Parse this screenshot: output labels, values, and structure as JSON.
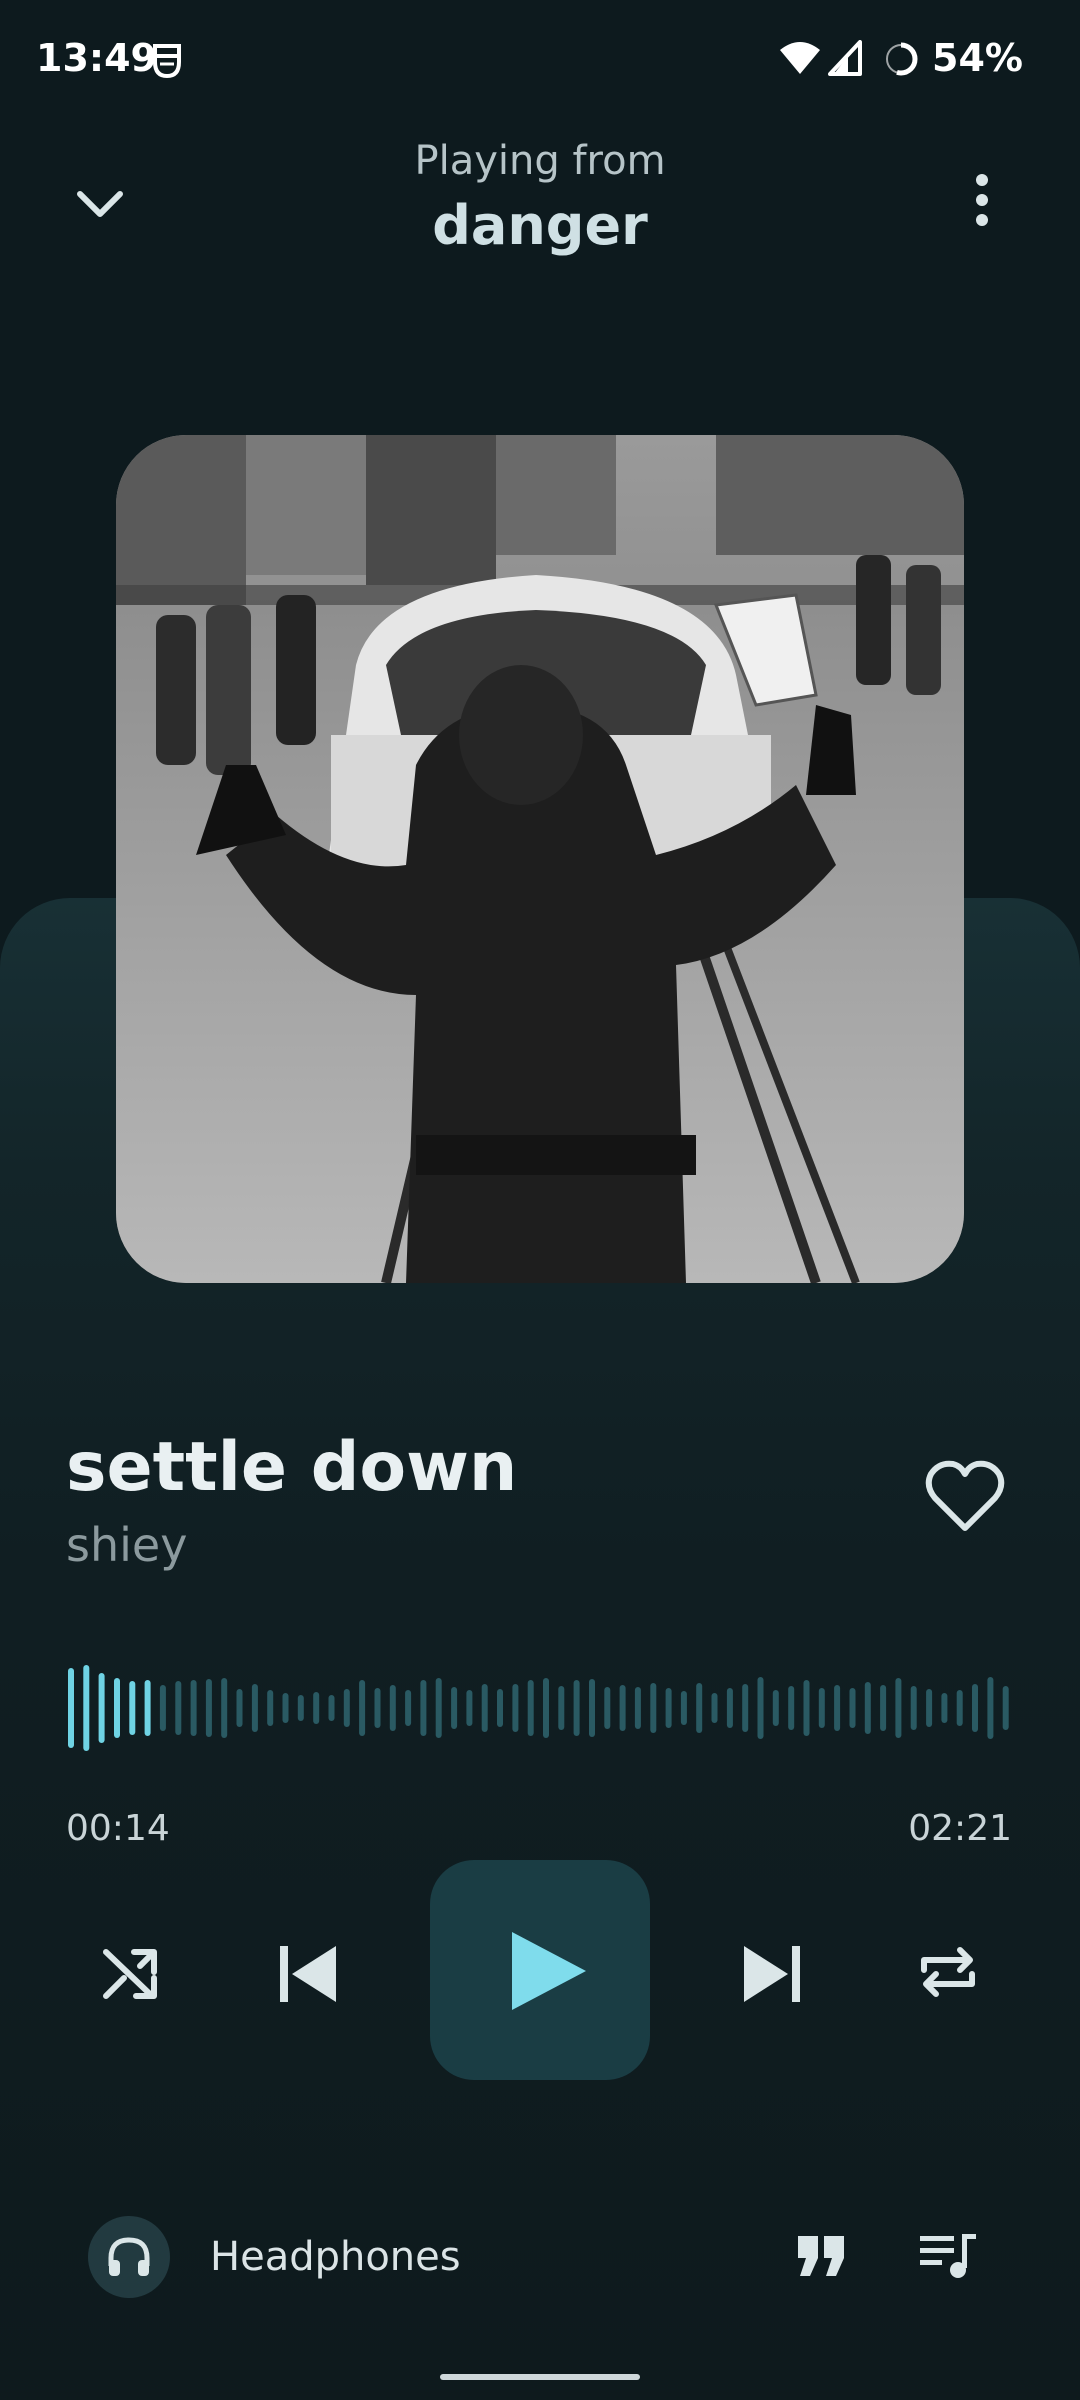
{
  "status_bar": {
    "time": "13:49",
    "battery": "54%"
  },
  "header": {
    "playing_from_label": "Playing from",
    "playlist_name": "danger"
  },
  "track": {
    "title": "settle down",
    "artist": "shiey"
  },
  "progress": {
    "current": "00:14",
    "total": "02:21",
    "fraction": 0.1
  },
  "output": {
    "device": "Headphones"
  },
  "icons": {
    "collapse": "chevron-down-icon",
    "menu": "more-vertical-icon",
    "like": "heart-outline-icon",
    "shuffle": "shuffle-icon",
    "previous": "skip-previous-icon",
    "play": "play-icon",
    "next": "skip-next-icon",
    "repeat": "repeat-icon",
    "device": "headphones-icon",
    "lyrics": "quote-icon",
    "queue": "queue-music-icon"
  },
  "colors": {
    "accent": "#6fd3e4",
    "waveform_inactive": "#2a5a63",
    "play_button_bg": "#1a3d44",
    "background": "#0d1a1e"
  }
}
